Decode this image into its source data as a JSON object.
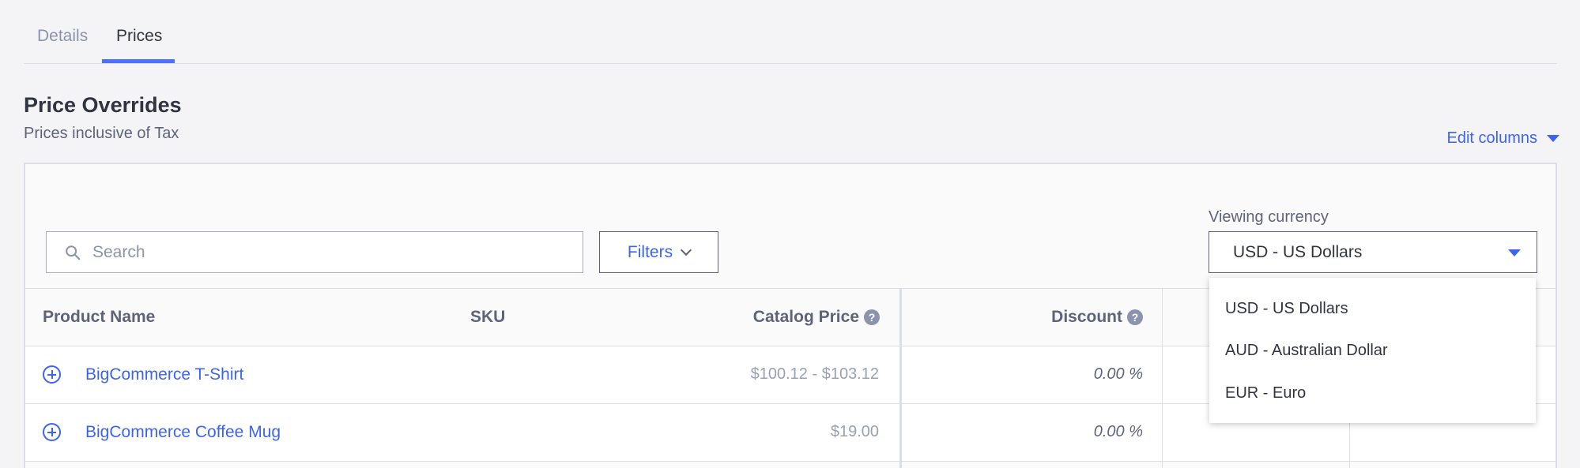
{
  "tabs": [
    {
      "label": "Details"
    },
    {
      "label": "Prices"
    }
  ],
  "section": {
    "title": "Price Overrides",
    "subtitle": "Prices inclusive of Tax",
    "edit_columns": "Edit columns"
  },
  "toolbar": {
    "search_placeholder": "Search",
    "filters_label": "Filters",
    "viewing_currency_label": "Viewing currency",
    "currency_value": "USD - US Dollars"
  },
  "table": {
    "headers": {
      "product_name": "Product Name",
      "sku": "SKU",
      "catalog_price": "Catalog Price",
      "discount": "Discount"
    },
    "rows": [
      {
        "name": "BigCommerce T-Shirt",
        "catalog_price": "$100.12 - $103.12",
        "discount": "0.00 %"
      },
      {
        "name": "BigCommerce Coffee Mug",
        "catalog_price": "$19.00",
        "discount": "0.00 %"
      }
    ]
  },
  "currency_dropdown": {
    "options": [
      "USD - US Dollars",
      "AUD - Australian Dollar",
      "EUR - Euro"
    ]
  },
  "colors": {
    "accent": "#3c64f4",
    "tab_underline": "#4b71fc",
    "text": "#313440",
    "muted": "#8c93ad"
  },
  "icons": {
    "search": "search-icon",
    "help": "help-icon",
    "expand": "plus-circle-icon"
  }
}
